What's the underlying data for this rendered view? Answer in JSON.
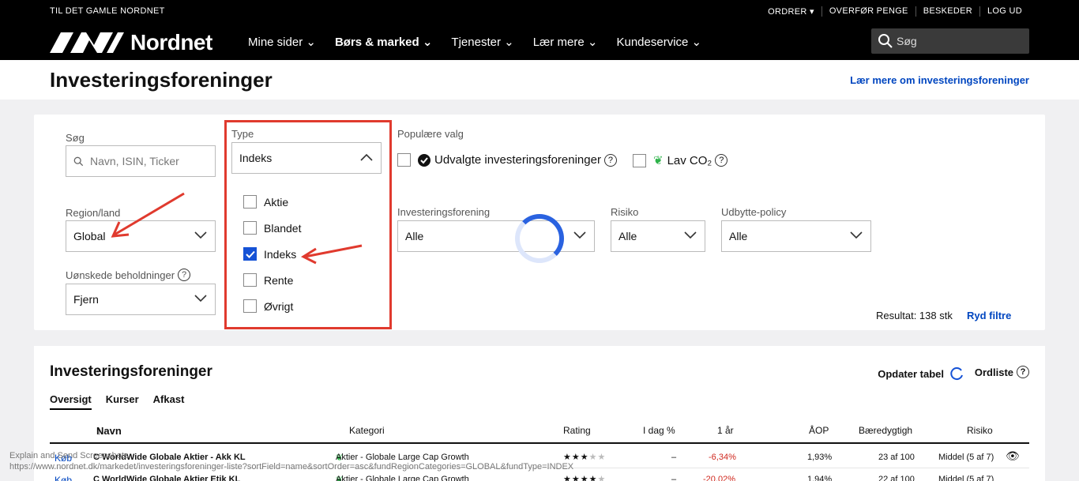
{
  "topbar": {
    "old_site": "TIL DET GAMLE NORDNET",
    "links": [
      "ORDRER",
      "OVERFØR PENGE",
      "BESKEDER",
      "LOG UD"
    ]
  },
  "nav": {
    "logo": "Nordnet",
    "items": [
      "Mine sider",
      "Børs & marked",
      "Tjenester",
      "Lær mere",
      "Kundeservice"
    ],
    "search_placeholder": "Søg"
  },
  "header": {
    "title": "Investeringsforeninger",
    "learn_more": "Lær mere om investeringsforeninger"
  },
  "filters": {
    "search": {
      "label": "Søg",
      "placeholder": "Navn, ISIN, Ticker"
    },
    "region": {
      "label": "Region/land",
      "value": "Global"
    },
    "holdings": {
      "label": "Uønskede beholdninger",
      "value": "Fjern"
    },
    "type": {
      "label": "Type",
      "value": "Indeks",
      "options": [
        {
          "label": "Aktie",
          "checked": false
        },
        {
          "label": "Blandet",
          "checked": false
        },
        {
          "label": "Indeks",
          "checked": true
        },
        {
          "label": "Rente",
          "checked": false
        },
        {
          "label": "Øvrigt",
          "checked": false
        }
      ]
    },
    "popular": {
      "label": "Populære valg",
      "selected": "Udvalgte investeringsforeninger",
      "lowco2": "Lav CO₂"
    },
    "fund": {
      "label": "Investeringsforening",
      "value": "Alle"
    },
    "risk": {
      "label": "Risiko",
      "value": "Alle"
    },
    "dividend": {
      "label": "Udbytte-policy",
      "value": "Alle"
    },
    "result_text": "Resultat: 138 stk",
    "clear": "Ryd filtre"
  },
  "results": {
    "title": "Investeringsforeninger",
    "update": "Opdater tabel",
    "watchlist": "Ordliste",
    "tabs": [
      "Oversigt",
      "Kurser",
      "Afkast"
    ],
    "columns": [
      "Navn",
      "Kategori",
      "Rating",
      "I dag %",
      "1 år",
      "ÅOP",
      "Bæredygtigh",
      "Risiko"
    ],
    "rows": [
      {
        "buy": "Køb",
        "name": "C WorldWide Globale Aktier - Akk KL",
        "category": "Aktier - Globale Large Cap Growth",
        "rating": 3,
        "today": "–",
        "year": "-6,34%",
        "aop": "1,93%",
        "esg": "23 af 100",
        "risk": "Middel (5 af 7)"
      },
      {
        "buy": "Køb",
        "name": "C WorldWide Globale Aktier Etik KL",
        "category": "Aktier - Globale Large Cap Growth",
        "rating": 4,
        "today": "–",
        "year": "-20,02%",
        "aop": "1,94%",
        "esg": "22 af 100",
        "risk": "Middel (5 af 7)"
      }
    ]
  },
  "status": {
    "line1": "Explain and Send Screenshots",
    "line2": "https://www.nordnet.dk/markedet/investeringsforeninger-liste?sortField=name&sortOrder=asc&fundRegionCategories=GLOBAL&fundType=INDEX"
  },
  "colors": {
    "accent": "#0046c0",
    "checked": "#1552d6",
    "annotation": "#e03a2e",
    "negative": "#d0281e"
  }
}
